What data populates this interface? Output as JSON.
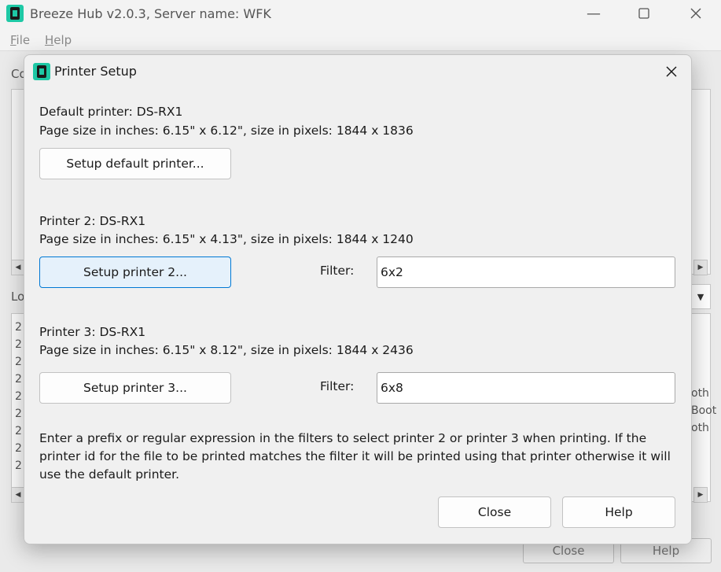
{
  "main_window": {
    "title": "Breeze Hub v2.0.3, Server name: WFK",
    "menu": [
      {
        "label": "File",
        "underline": "F",
        "rest": "ile"
      },
      {
        "label": "Help",
        "underline": "H",
        "rest": "elp"
      }
    ],
    "background": {
      "label_top": "Co",
      "label_log": "Lo",
      "log_digits": [
        "2",
        "2",
        "2",
        "2",
        "2",
        "2",
        "2",
        "2",
        "2"
      ],
      "right_fragments": [
        "oth",
        "Boot",
        "oth"
      ],
      "close_label": "Close",
      "help_label": "Help"
    }
  },
  "dialog": {
    "title": "Printer Setup",
    "default_printer": {
      "name_line": "Default printer: DS-RX1",
      "size_line": "Page size in inches: 6.15\" x 6.12\", size in pixels: 1844 x 1836",
      "button": "Setup default printer..."
    },
    "printer2": {
      "name_line": "Printer 2: DS-RX1",
      "size_line": "Page size in inches: 6.15\" x 4.13\", size in pixels: 1844 x 1240",
      "button": "Setup printer 2...",
      "filter_label": "Filter:",
      "filter_value": "6x2"
    },
    "printer3": {
      "name_line": "Printer 3: DS-RX1",
      "size_line": "Page size in inches: 6.15\" x 8.12\", size in pixels: 1844 x 2436",
      "button": "Setup printer 3...",
      "filter_label": "Filter:",
      "filter_value": "6x8"
    },
    "help_text": "Enter a prefix or regular expression in the filters to select printer 2 or printer 3 when printing. If the printer id for the file to be printed matches the filter it will be printed using that printer otherwise it will use the default printer.",
    "close_button": "Close",
    "help_button": "Help"
  },
  "colors": {
    "accent": "#0078d4",
    "icon_teal": "#1ec8a5",
    "icon_dark": "#1a1a1a"
  }
}
